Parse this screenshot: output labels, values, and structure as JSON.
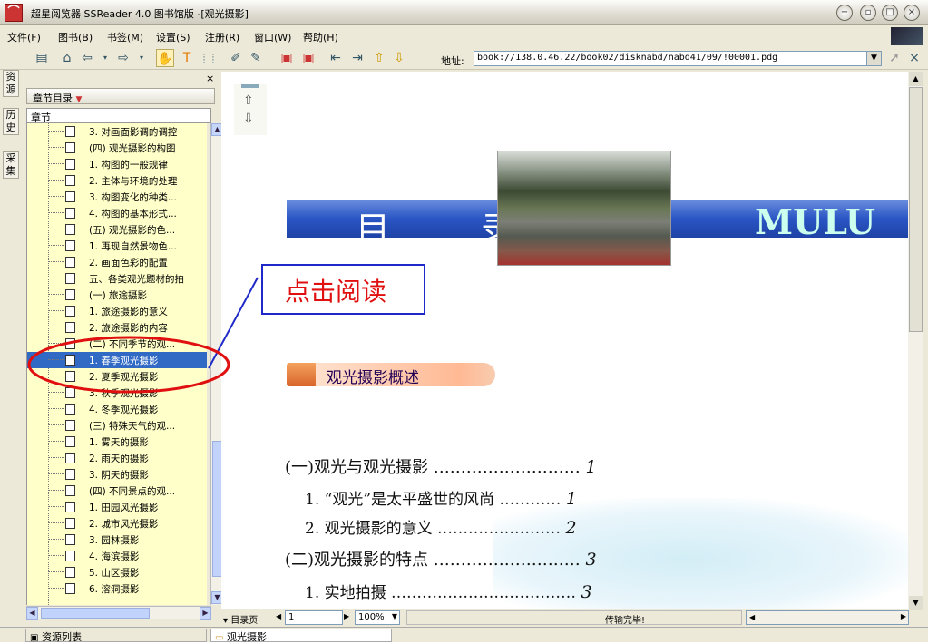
{
  "window": {
    "title": "超星阅览器 SSReader 4.0 图书馆版 -[观光摄影]",
    "app_icon": "ssreader-logo-icon",
    "controls": [
      "minimize-button",
      "restore-button",
      "maximize-button",
      "close-button"
    ]
  },
  "menubar": [
    {
      "label": "文件(F)"
    },
    {
      "label": "图书(B)"
    },
    {
      "label": "书签(M)"
    },
    {
      "label": "设置(S)"
    },
    {
      "label": "注册(R)"
    },
    {
      "label": "窗口(W)"
    },
    {
      "label": "帮助(H)"
    }
  ],
  "toolbar": {
    "address_label": "地址:",
    "address_value": "book://138.0.46.22/book02/disknabd/nabd41/09/!00001.pdg",
    "close_glyph": "×"
  },
  "left_tabs": [
    "资源",
    "历史",
    "采集"
  ],
  "panel": {
    "header_label": "章节目录",
    "close_glyph": "×",
    "column_header": "章节",
    "tree_items": [
      {
        "label": "3. 对画面影调的调控"
      },
      {
        "label": "(四) 观光摄影的构图"
      },
      {
        "label": "1. 构图的一般规律"
      },
      {
        "label": "2. 主体与环境的处理"
      },
      {
        "label": "3. 构图变化的种类..."
      },
      {
        "label": "4. 构图的基本形式..."
      },
      {
        "label": "(五) 观光摄影的色..."
      },
      {
        "label": "1. 再现自然景物色..."
      },
      {
        "label": "2. 画面色彩的配置"
      },
      {
        "label": "五、各类观光题材的拍"
      },
      {
        "label": "(一) 旅途摄影"
      },
      {
        "label": "1. 旅途摄影的意义"
      },
      {
        "label": "2. 旅途摄影的内容"
      },
      {
        "label": "(二) 不同季节的观..."
      },
      {
        "label": "1. 春季观光摄影",
        "selected": true
      },
      {
        "label": "2. 夏季观光摄影"
      },
      {
        "label": "3. 秋季观光摄影"
      },
      {
        "label": "4. 冬季观光摄影"
      },
      {
        "label": "(三) 特殊天气的观..."
      },
      {
        "label": "1. 雾天的摄影"
      },
      {
        "label": "2. 雨天的摄影"
      },
      {
        "label": "3. 阴天的摄影"
      },
      {
        "label": "(四) 不同景点的观..."
      },
      {
        "label": "1. 田园风光摄影"
      },
      {
        "label": "2. 城市风光摄影"
      },
      {
        "label": "3. 园林摄影"
      },
      {
        "label": "4. 海滨摄影"
      },
      {
        "label": "5. 山区摄影"
      },
      {
        "label": "6. 溶洞摄影"
      }
    ]
  },
  "document": {
    "band_left": "目 录",
    "band_right": "MULU",
    "section_title": "观光摄影概述",
    "toc": [
      {
        "text": "(一)观光与观光摄影 ………………………",
        "page": "1"
      },
      {
        "text": "1. “观光”是太平盛世的风尚 …………",
        "page": "1"
      },
      {
        "text": "2. 观光摄影的意义 ……………………",
        "page": "2"
      },
      {
        "text": "(二)观光摄影的特点 ………………………",
        "page": "3"
      },
      {
        "text": "1. 实地拍摄 ………………………………",
        "page": "3"
      }
    ]
  },
  "annotation": {
    "callout_text": "点击阅读",
    "colors": {
      "box": "#1f29c9",
      "text": "#e01010",
      "ellipse": "#e01010"
    }
  },
  "statusbar": {
    "toc_page_label": "目录页",
    "page_value": "1",
    "zoom_value": "100%",
    "status_text": "传输完毕!"
  },
  "bottom": {
    "resource_list_label": "资源列表",
    "tab_label": "观光摄影"
  },
  "colors": {
    "selection": "#316ac5",
    "tree_bg": "#ffffc9",
    "band": "#2a55c4"
  }
}
